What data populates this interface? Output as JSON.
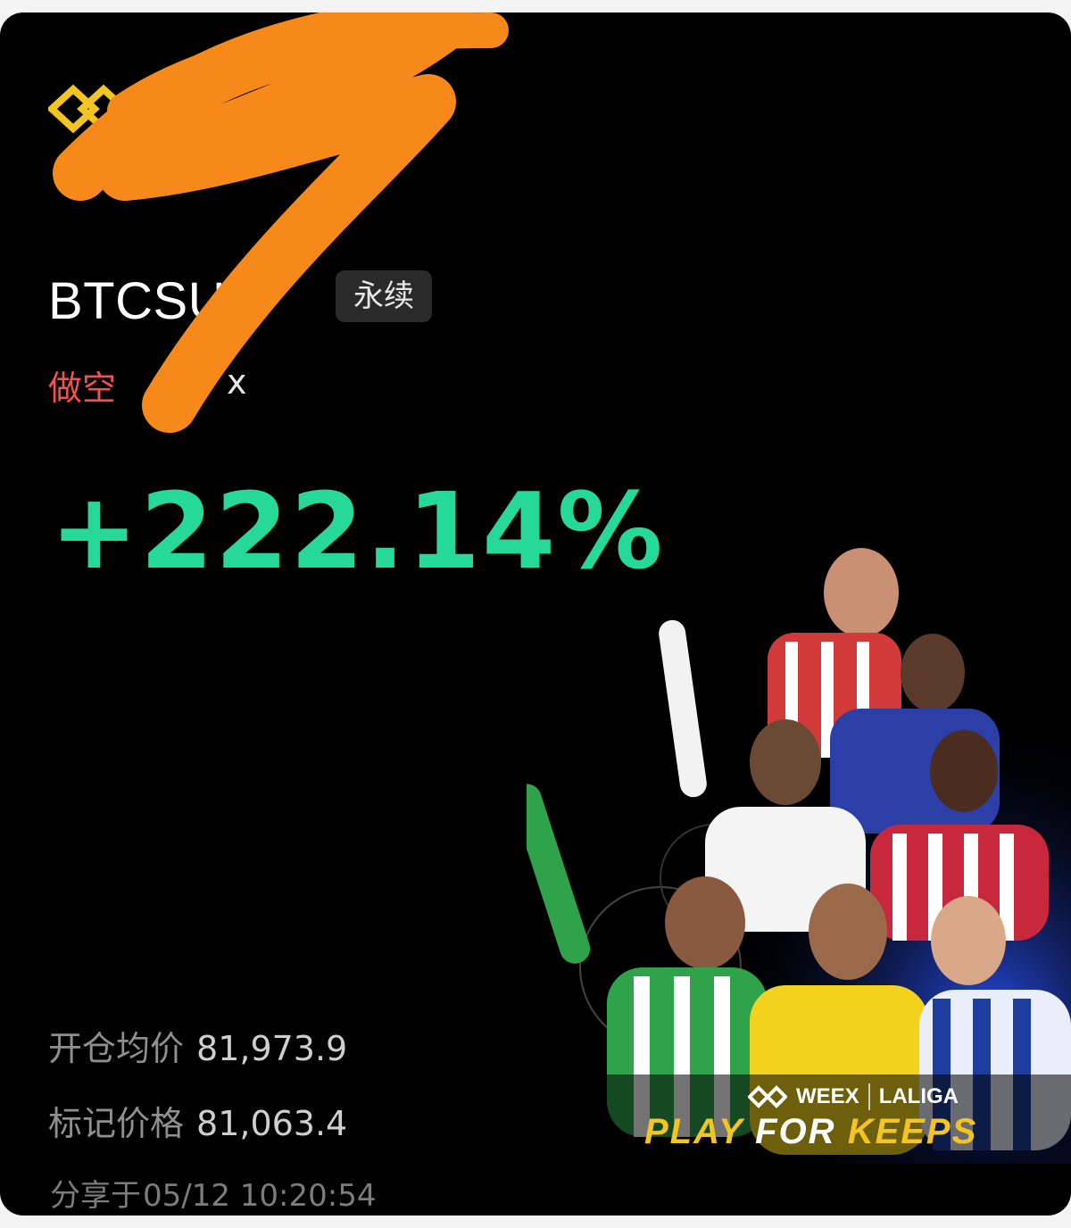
{
  "position": {
    "symbol": "BTCSUS",
    "badge": "永续",
    "direction": "做空",
    "leverage_partial": "x",
    "pnl_percent": "+222.14%"
  },
  "details": {
    "avg_open_label": "开仓均价",
    "avg_open_value": "81,973.9",
    "mark_label": "标记价格",
    "mark_value": "81,063.4",
    "shared_label": "分享于",
    "shared_time": "05/12 10:20:54"
  },
  "promo": {
    "brand": "WEEX",
    "partner": "LALIGA",
    "tagline_a": "PLAY",
    "tagline_b": "FOR",
    "tagline_c": "KEEPS"
  },
  "colors": {
    "background": "#000000",
    "profit": "#26d99b",
    "short": "#f0524f",
    "accent": "#f3c522",
    "redaction": "#f7891b"
  }
}
